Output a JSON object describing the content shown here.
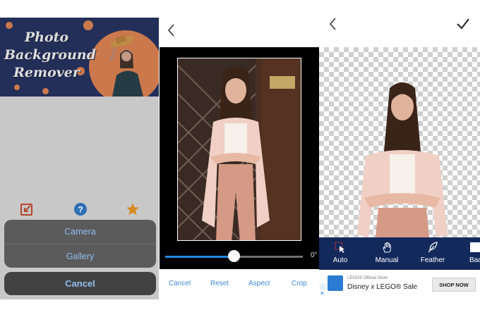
{
  "colors": {
    "banner_bg": "#1b2a5c",
    "banner_accent": "#e8844d",
    "sheet_text": "#8fbdf0",
    "slider_accent": "#1e88e5",
    "editor_action": "#3f8ad6",
    "toolbar_bg": "#13295c"
  },
  "launcher": {
    "banner_title": [
      "Photo",
      "Background",
      "Remover"
    ],
    "icons": [
      "import-icon",
      "help-icon",
      "star-icon"
    ],
    "sheet": {
      "options": [
        "Camera",
        "Gallery"
      ],
      "cancel": "Cancel"
    }
  },
  "crop": {
    "back_icon": "chevron-left-icon",
    "rotation_label": "0°",
    "rotation_fraction": 0.5,
    "actions": [
      "Cancel",
      "Reset",
      "Aspect",
      "Crop"
    ]
  },
  "eraser": {
    "back_icon": "chevron-left-icon",
    "confirm_icon": "checkmark-icon",
    "tools": [
      {
        "label": "Auto",
        "icon": "auto-select-icon"
      },
      {
        "label": "Manual",
        "icon": "hand-icon"
      },
      {
        "label": "Feather",
        "icon": "feather-icon"
      },
      {
        "label": "Backg",
        "icon": "background-icon"
      }
    ],
    "ad": {
      "sponsor": "LEGO® Official Store",
      "title": "Disney x LEGO® Sale",
      "cta": "SHOP NOW"
    }
  }
}
